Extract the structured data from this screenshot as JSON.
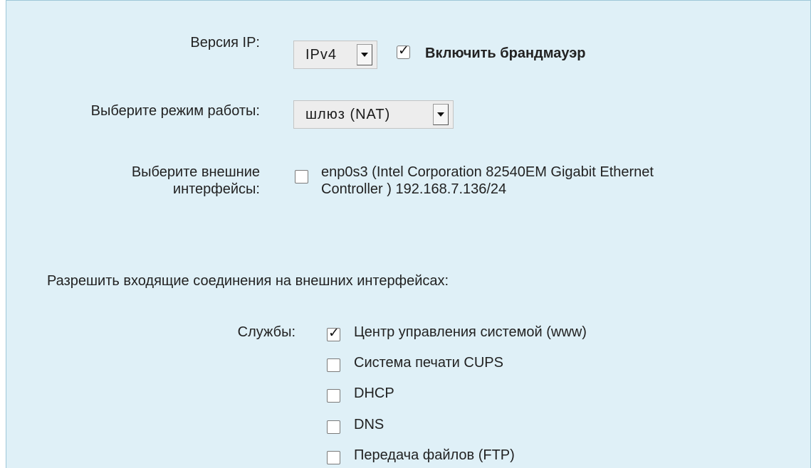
{
  "ip_version": {
    "label": "Версия IP:",
    "selected": "IPv4"
  },
  "firewall": {
    "label": "Включить брандмауэр",
    "checked": true
  },
  "mode": {
    "label": "Выберите режим работы:",
    "selected": "шлюз (NAT)"
  },
  "external_interfaces": {
    "label_line1": "Выберите внешние",
    "label_line2": "интерфейсы:",
    "items": [
      {
        "line1": "enp0s3 (Intel Corporation 82540EM Gigabit Ethernet",
        "line2": "Controller ) 192.168.7.136/24",
        "checked": false
      }
    ]
  },
  "incoming": {
    "heading": "Разрешить входящие соединения на внешних интерфейсах:"
  },
  "services": {
    "label": "Службы:",
    "items": [
      {
        "label": "Центр управления системой (www)",
        "checked": true
      },
      {
        "label": "Система печати CUPS",
        "checked": false
      },
      {
        "label": "DHCP",
        "checked": false
      },
      {
        "label": "DNS",
        "checked": false
      },
      {
        "label": "Передача файлов (FTP)",
        "checked": false
      }
    ]
  },
  "icons": {
    "dropdown": "chevron-down-icon",
    "check": "checkmark-icon"
  },
  "colors": {
    "panel_bg": "#dff0f7",
    "panel_border": "#9ec7d8"
  }
}
